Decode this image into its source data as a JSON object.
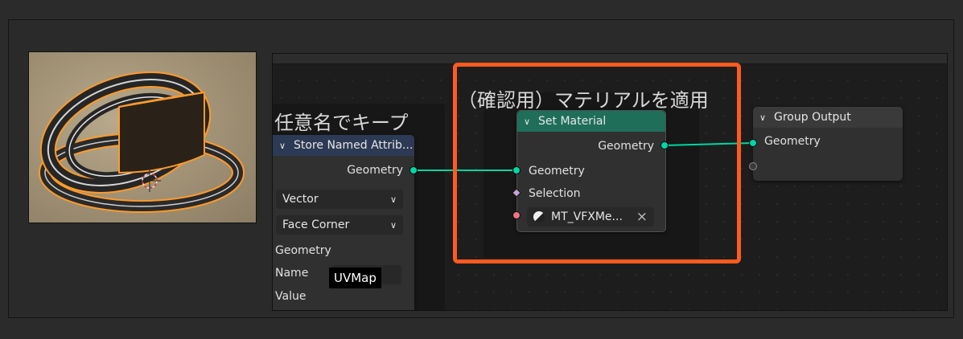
{
  "viewport": {
    "label": "3d-viewport-preview"
  },
  "store_node": {
    "frame_title": "任意名でキープ",
    "header": "Store Named Attrib...",
    "output_geometry": "Geometry",
    "data_type": "Vector",
    "domain": "Face Corner",
    "geometry_label": "Geometry",
    "name_label": "Name",
    "name_value": "UVMap",
    "value_label": "Value"
  },
  "set_material_node": {
    "frame_title": "（確認用）マテリアルを適用",
    "header": "Set Material",
    "output_geometry": "Geometry",
    "input_geometry": "Geometry",
    "selection": "Selection",
    "material_value": "MT_VFXMe...",
    "clear_icon": "×"
  },
  "group_output_node": {
    "header": "Group Output",
    "input_geometry": "Geometry"
  },
  "colors": {
    "geometry_socket": "#00d6a3",
    "material_socket": "#eb7582",
    "set_material_header": "#1e6e5a",
    "store_header": "#2d3a55",
    "highlight_box": "#ff5a1f"
  }
}
